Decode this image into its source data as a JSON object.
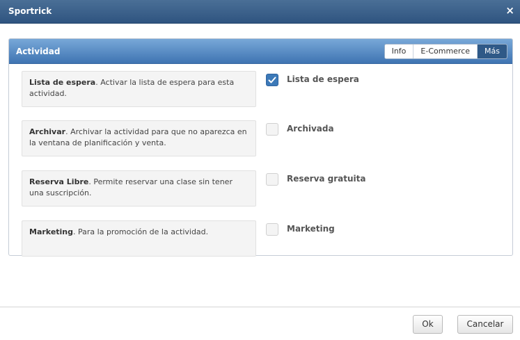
{
  "window": {
    "title": "Sportrick",
    "close_label": "×"
  },
  "panel": {
    "title": "Actividad",
    "tabs": [
      {
        "label": "Info",
        "active": false
      },
      {
        "label": "E-Commerce",
        "active": false
      },
      {
        "label": "Más",
        "active": true
      }
    ]
  },
  "options": [
    {
      "desc_title": "Lista de espera",
      "desc_text": ". Activar la lista de espera para esta actividad.",
      "checkbox_label": "Lista de espera",
      "checked": true
    },
    {
      "desc_title": "Archivar",
      "desc_text": ". Archivar la actividad para que no aparezca en la ventana de planificación y venta.",
      "checkbox_label": "Archivada",
      "checked": false
    },
    {
      "desc_title": "Reserva Libre",
      "desc_text": ". Permite reservar una clase sin tener una suscripción.",
      "checkbox_label": "Reserva gratuita",
      "checked": false
    },
    {
      "desc_title": "Marketing",
      "desc_text": ". Para la promoción de la actividad.",
      "checkbox_label": "Marketing",
      "checked": false
    }
  ],
  "footer": {
    "ok_label": "Ok",
    "cancel_label": "Cancelar"
  },
  "colors": {
    "titlebar": "#2f5480",
    "panel_header": "#3f74b2",
    "active_tab": "#2f5987",
    "checkbox_checked": "#3c79b8"
  }
}
